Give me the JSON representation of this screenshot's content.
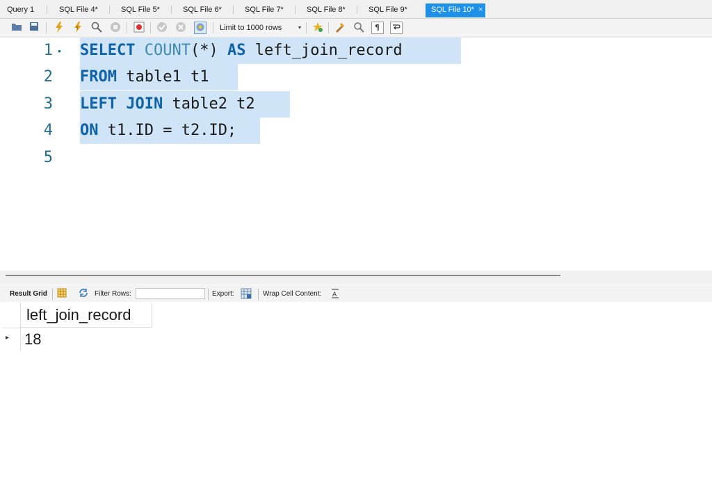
{
  "tabs": [
    {
      "label": "Query 1",
      "active": false
    },
    {
      "label": "SQL File 4*",
      "active": false
    },
    {
      "label": "SQL File 5*",
      "active": false
    },
    {
      "label": "SQL File 6*",
      "active": false
    },
    {
      "label": "SQL File 7*",
      "active": false
    },
    {
      "label": "SQL File 8*",
      "active": false
    },
    {
      "label": "SQL File 9*",
      "active": false
    },
    {
      "label": "SQL File 10*",
      "active": true
    }
  ],
  "tab_close_glyph": "×",
  "toolbar": {
    "limit_label": "Limit to 1000 rows",
    "limit_arrow": "▾",
    "icons": [
      "open-folder-icon",
      "save-icon",
      "execute-icon",
      "execute-current-icon",
      "explain-icon",
      "stop-icon",
      "toggle-error-icon",
      "commit-icon",
      "rollback-icon",
      "autocommit-icon",
      "add-snippet-icon",
      "beautify-icon",
      "find-icon",
      "invisibles-icon",
      "wrap-icon"
    ]
  },
  "editor": {
    "lines": [
      {
        "no": "1",
        "marker": "•"
      },
      {
        "no": "2",
        "marker": ""
      },
      {
        "no": "3",
        "marker": ""
      },
      {
        "no": "4",
        "marker": ""
      },
      {
        "no": "5",
        "marker": ""
      }
    ],
    "code": {
      "l1_kw1": "SELECT",
      "l1_fn": "COUNT",
      "l1_paren": "(*)",
      "l1_kw2": "AS",
      "l1_alias": "left_join_record",
      "l2_kw": "FROM",
      "l2_rest": "table1 t1",
      "l3_kw": "LEFT JOIN",
      "l3_rest": "table2 t2",
      "l4_kw": "ON",
      "l4_rest": "t1.ID = t2.ID;"
    }
  },
  "result_toolbar": {
    "result_grid_label": "Result Grid",
    "filter_label": "Filter Rows:",
    "filter_value": "",
    "export_label": "Export:",
    "wrap_label": "Wrap Cell Content:"
  },
  "grid": {
    "columns": [
      "left_join_record"
    ],
    "rows": [
      [
        "18"
      ]
    ],
    "row_marker": "▸"
  },
  "colors": {
    "active_tab": "#1e90e8",
    "selection": "#cfe4f6",
    "keyword": "#0e63a8",
    "line_number": "#236e8c"
  }
}
